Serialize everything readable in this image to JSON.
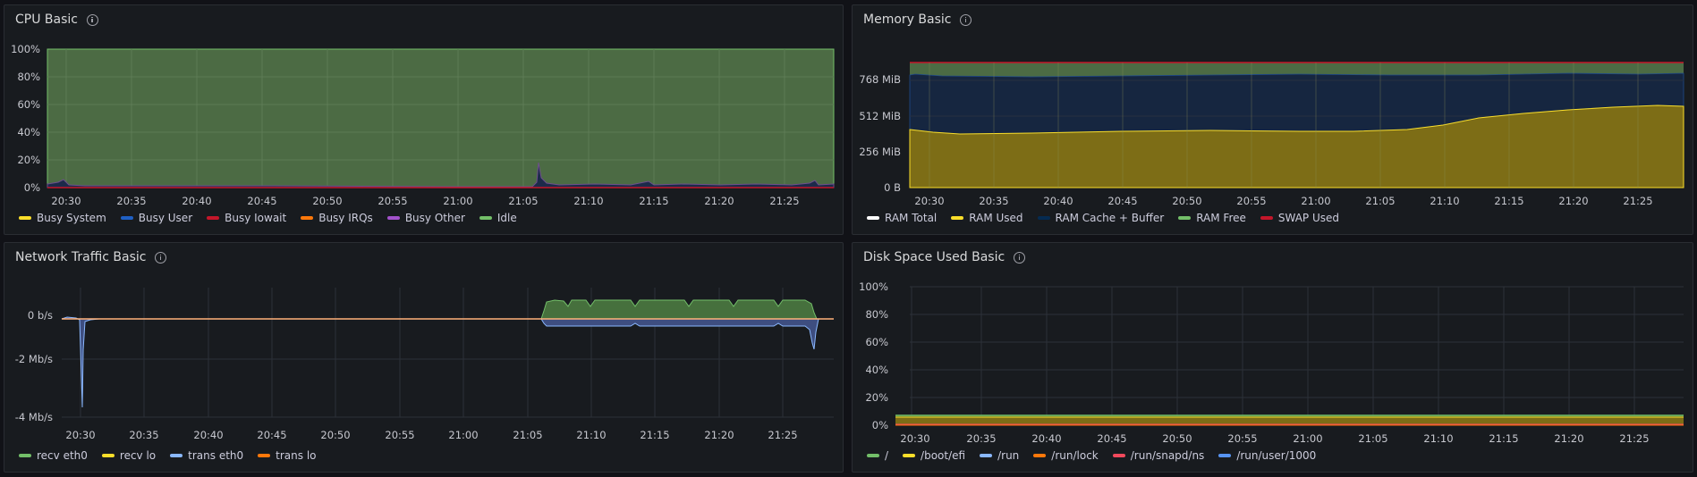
{
  "panels": {
    "cpu": {
      "title": "CPU Basic",
      "y_ticks": [
        "100%",
        "80%",
        "60%",
        "40%",
        "20%",
        "0%"
      ],
      "x_ticks": [
        "20:30",
        "20:35",
        "20:40",
        "20:45",
        "20:50",
        "20:55",
        "21:00",
        "21:05",
        "21:10",
        "21:15",
        "21:20",
        "21:25"
      ],
      "legend": [
        {
          "label": "Busy System",
          "color": "#fade2a"
        },
        {
          "label": "Busy User",
          "color": "#1f60c4"
        },
        {
          "label": "Busy Iowait",
          "color": "#c4162a"
        },
        {
          "label": "Busy IRQs",
          "color": "#ff780a"
        },
        {
          "label": "Busy Other",
          "color": "#a352cc"
        },
        {
          "label": "Idle",
          "color": "#73bf69"
        }
      ]
    },
    "memory": {
      "title": "Memory Basic",
      "y_ticks": [
        "768 MiB",
        "512 MiB",
        "256 MiB",
        "0 B"
      ],
      "x_ticks": [
        "20:30",
        "20:35",
        "20:40",
        "20:45",
        "20:50",
        "20:55",
        "21:00",
        "21:05",
        "21:10",
        "21:15",
        "21:20",
        "21:25"
      ],
      "legend": [
        {
          "label": "RAM Total",
          "color": "#ffffff"
        },
        {
          "label": "RAM Used",
          "color": "#fade2a"
        },
        {
          "label": "RAM Cache + Buffer",
          "color": "#052b51"
        },
        {
          "label": "RAM Free",
          "color": "#73bf69"
        },
        {
          "label": "SWAP Used",
          "color": "#c4162a"
        }
      ]
    },
    "network": {
      "title": "Network Traffic Basic",
      "y_ticks": [
        "0 b/s",
        "-2 Mb/s",
        "-4 Mb/s"
      ],
      "x_ticks": [
        "20:30",
        "20:35",
        "20:40",
        "20:45",
        "20:50",
        "20:55",
        "21:00",
        "21:05",
        "21:10",
        "21:15",
        "21:20",
        "21:25"
      ],
      "legend": [
        {
          "label": "recv eth0",
          "color": "#73bf69"
        },
        {
          "label": "recv lo",
          "color": "#fade2a"
        },
        {
          "label": "trans eth0",
          "color": "#8ab8ff"
        },
        {
          "label": "trans lo",
          "color": "#ff780a"
        }
      ]
    },
    "disk": {
      "title": "Disk Space Used Basic",
      "y_ticks": [
        "100%",
        "80%",
        "60%",
        "40%",
        "20%",
        "0%"
      ],
      "x_ticks": [
        "20:30",
        "20:35",
        "20:40",
        "20:45",
        "20:50",
        "20:55",
        "21:00",
        "21:05",
        "21:10",
        "21:15",
        "21:20",
        "21:25"
      ],
      "legend": [
        {
          "label": "/",
          "color": "#73bf69"
        },
        {
          "label": "/boot/efi",
          "color": "#fade2a"
        },
        {
          "label": "/run",
          "color": "#8ab8ff"
        },
        {
          "label": "/run/lock",
          "color": "#ff780a"
        },
        {
          "label": "/run/snapd/ns",
          "color": "#f2495c"
        },
        {
          "label": "/run/user/1000",
          "color": "#5794f2"
        }
      ]
    }
  },
  "chart_data": [
    {
      "type": "area",
      "title": "CPU Basic",
      "x": [
        "20:30",
        "20:35",
        "20:40",
        "20:45",
        "20:50",
        "20:55",
        "21:00",
        "21:05",
        "21:06",
        "21:10",
        "21:15",
        "21:20",
        "21:25",
        "21:28"
      ],
      "ylim": [
        0,
        100
      ],
      "series": [
        {
          "name": "Busy System",
          "values": [
            1,
            1,
            1,
            1,
            1,
            1,
            1,
            1,
            3,
            1,
            1,
            1,
            1,
            1
          ]
        },
        {
          "name": "Busy User",
          "values": [
            2,
            1,
            1,
            1,
            1,
            1,
            1,
            1,
            15,
            3,
            2,
            2,
            2,
            3
          ]
        },
        {
          "name": "Busy Iowait",
          "values": [
            0,
            0,
            0,
            0,
            0,
            0,
            0,
            0,
            2,
            0,
            0,
            0,
            0,
            0
          ]
        },
        {
          "name": "Busy IRQs",
          "values": [
            0,
            0,
            0,
            0,
            0,
            0,
            0,
            0,
            0,
            0,
            0,
            0,
            0,
            0
          ]
        },
        {
          "name": "Busy Other",
          "values": [
            0,
            0,
            0,
            0,
            0,
            0,
            0,
            0,
            0,
            0,
            0,
            0,
            0,
            0
          ]
        },
        {
          "name": "Idle",
          "values": [
            97,
            98,
            98,
            98,
            98,
            98,
            98,
            98,
            80,
            96,
            97,
            97,
            97,
            96
          ]
        }
      ]
    },
    {
      "type": "area",
      "title": "Memory Basic",
      "x": [
        "20:30",
        "20:35",
        "20:40",
        "20:45",
        "20:50",
        "20:55",
        "21:00",
        "21:05",
        "21:10",
        "21:15",
        "21:20",
        "21:25",
        "21:28"
      ],
      "ylim": [
        0,
        1024
      ],
      "series": [
        {
          "name": "RAM Total",
          "values": [
            910,
            910,
            910,
            910,
            910,
            910,
            910,
            910,
            910,
            910,
            910,
            910,
            910
          ]
        },
        {
          "name": "RAM Used",
          "values": [
            410,
            400,
            405,
            410,
            405,
            400,
            400,
            400,
            440,
            490,
            520,
            560,
            580
          ]
        },
        {
          "name": "RAM Cache + Buffer",
          "values": [
            380,
            395,
            395,
            395,
            400,
            405,
            400,
            400,
            390,
            360,
            340,
            300,
            290
          ]
        },
        {
          "name": "RAM Free",
          "values": [
            120,
            115,
            110,
            105,
            105,
            105,
            110,
            110,
            80,
            60,
            50,
            50,
            40
          ]
        },
        {
          "name": "SWAP Used",
          "values": [
            0,
            0,
            0,
            0,
            0,
            0,
            0,
            0,
            0,
            0,
            0,
            0,
            0
          ]
        }
      ]
    },
    {
      "type": "area",
      "title": "Network Traffic Basic",
      "x": [
        "20:30",
        "20:31",
        "20:35",
        "20:40",
        "20:45",
        "20:50",
        "20:55",
        "21:00",
        "21:05",
        "21:06",
        "21:10",
        "21:15",
        "21:20",
        "21:25",
        "21:27",
        "21:28"
      ],
      "unit": "Mb/s",
      "series": [
        {
          "name": "recv eth0",
          "values": [
            0.05,
            0.05,
            0,
            0,
            0,
            0,
            0,
            0,
            0,
            0.95,
            0.95,
            0.95,
            0.95,
            0.95,
            0.3,
            0
          ]
        },
        {
          "name": "recv lo",
          "values": [
            0,
            0,
            0,
            0,
            0,
            0,
            0,
            0,
            0,
            0,
            0,
            0,
            0,
            0,
            0,
            0
          ]
        },
        {
          "name": "trans eth0",
          "values": [
            -0.05,
            -3.75,
            0,
            0,
            0,
            0,
            0,
            0,
            0,
            -0.4,
            -0.4,
            -0.4,
            -0.4,
            -0.4,
            -1.8,
            0
          ]
        },
        {
          "name": "trans lo",
          "values": [
            0,
            0,
            0,
            0,
            0,
            0,
            0,
            0,
            0,
            0,
            0,
            0,
            0,
            0,
            0,
            0
          ]
        }
      ]
    },
    {
      "type": "line",
      "title": "Disk Space Used Basic",
      "x": [
        "20:30",
        "20:35",
        "20:40",
        "20:45",
        "20:50",
        "20:55",
        "21:00",
        "21:05",
        "21:10",
        "21:15",
        "21:20",
        "21:25",
        "21:28"
      ],
      "ylim": [
        0,
        100
      ],
      "series": [
        {
          "name": "/",
          "values": [
            7,
            7,
            7,
            7,
            7,
            7,
            7,
            7,
            7,
            7,
            7,
            7,
            7
          ]
        },
        {
          "name": "/boot/efi",
          "values": [
            6,
            6,
            6,
            6,
            6,
            6,
            6,
            6,
            6,
            6,
            6,
            6,
            6
          ]
        },
        {
          "name": "/run",
          "values": [
            0.5,
            0.5,
            0.5,
            0.5,
            0.5,
            0.5,
            0.5,
            0.5,
            0.5,
            0.5,
            0.5,
            0.5,
            0.5
          ]
        },
        {
          "name": "/run/lock",
          "values": [
            0,
            0,
            0,
            0,
            0,
            0,
            0,
            0,
            0,
            0,
            0,
            0,
            0
          ]
        },
        {
          "name": "/run/snapd/ns",
          "values": [
            0.5,
            0.5,
            0.5,
            0.5,
            0.5,
            0.5,
            0.5,
            0.5,
            0.5,
            0.5,
            0.5,
            0.5,
            0.5
          ]
        },
        {
          "name": "/run/user/1000",
          "values": [
            0,
            0,
            0,
            0,
            0,
            0,
            0,
            0,
            0,
            0,
            0,
            0,
            0
          ]
        }
      ]
    }
  ]
}
